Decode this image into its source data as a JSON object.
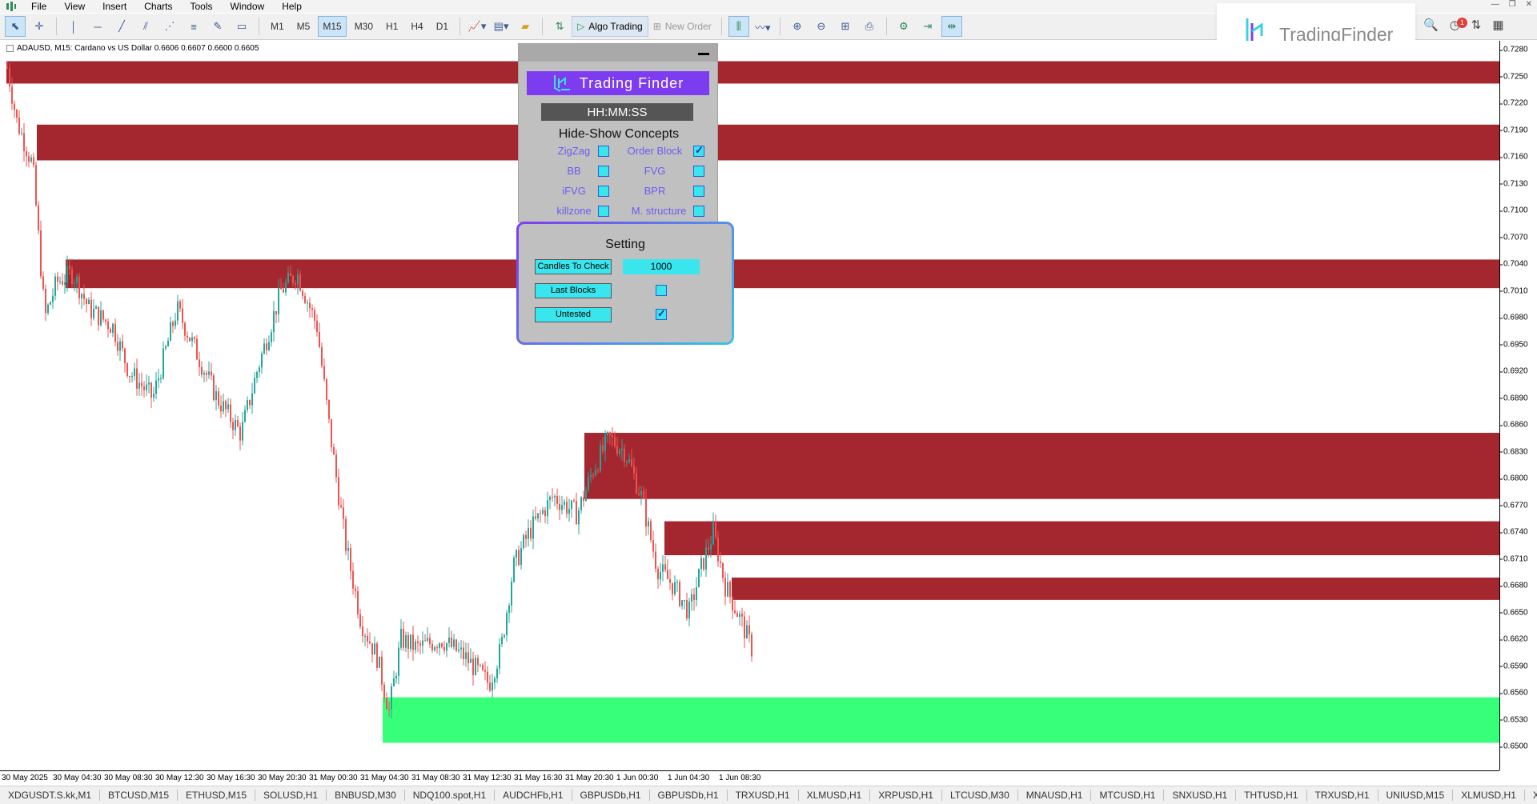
{
  "menu": [
    "File",
    "View",
    "Insert",
    "Charts",
    "Tools",
    "Window",
    "Help"
  ],
  "toolbar": {
    "timeframes": [
      "M1",
      "M5",
      "M15",
      "M30",
      "H1",
      "H4",
      "D1"
    ],
    "active_timeframe": "M15",
    "algo_trading": "Algo Trading",
    "new_order": "New Order"
  },
  "watermark": "TradingFinder",
  "notifications_count": "1",
  "chart": {
    "title": "ADAUSD, M15:  Cardano vs US Dollar  0.6606 0.6607 0.6600 0.6605",
    "price_ticks": [
      "0.7280",
      "0.7250",
      "0.7220",
      "0.7190",
      "0.7160",
      "0.7130",
      "0.7100",
      "0.7070",
      "0.7040",
      "0.7010",
      "0.6980",
      "0.6950",
      "0.6920",
      "0.6890",
      "0.6860",
      "0.6830",
      "0.6800",
      "0.6770",
      "0.6740",
      "0.6710",
      "0.6680",
      "0.6650",
      "0.6620",
      "0.6590",
      "0.6560",
      "0.6530",
      "0.6500"
    ],
    "time_ticks": [
      "30 May 2025",
      "30 May 04:30",
      "30 May 08:30",
      "30 May 12:30",
      "30 May 16:30",
      "30 May 20:30",
      "31 May 00:30",
      "31 May 04:30",
      "31 May 08:30",
      "31 May 12:30",
      "31 May 16:30",
      "31 May 20:30",
      "1 Jun 00:30",
      "1 Jun 04:30",
      "1 Jun 08:30"
    ],
    "colors": {
      "bull": "#26a69a",
      "bear": "#ef5350",
      "supply_zone": "#a4262f",
      "demand_zone": "#38ff7a"
    }
  },
  "panel": {
    "logo_text": "Trading Finder",
    "clock": "HH:MM:SS",
    "concepts_title": "Hide-Show Concepts",
    "concepts": [
      {
        "label": "ZigZag",
        "checked": false
      },
      {
        "label": "Order Block",
        "checked": true
      },
      {
        "label": "BB",
        "checked": false
      },
      {
        "label": "FVG",
        "checked": false
      },
      {
        "label": "iFVG",
        "checked": false
      },
      {
        "label": "BPR",
        "checked": false
      },
      {
        "label": "killzone",
        "checked": false
      },
      {
        "label": "M. structure",
        "checked": false
      }
    ],
    "setting_title": "Setting",
    "candles_to_check_label": "Candles To Check",
    "candles_to_check_value": "1000",
    "last_blocks_label": "Last Blocks",
    "last_blocks_checked": false,
    "untested_label": "Untested",
    "untested_checked": true
  },
  "tabs": [
    "XDGUSDT.S.kk,M1",
    "BTCUSD,M15",
    "ETHUSD,M15",
    "SOLUSD,H1",
    "BNBUSD,M30",
    "NDQ100.spot,H1",
    "AUDCHFb,H1",
    "GBPUSDb,H1",
    "GBPUSDb,H1",
    "TRXUSD,H1",
    "XLMUSD,H1",
    "XRPUSD,H1",
    "LTCUSD,M30",
    "MNAUSD,H1",
    "MTCUSD,H1",
    "SNXUSD,H1",
    "THTUSD,H1",
    "TRXUSD,H1",
    "UNIUSD,M15",
    "XLMUSD,H1",
    "X"
  ]
}
